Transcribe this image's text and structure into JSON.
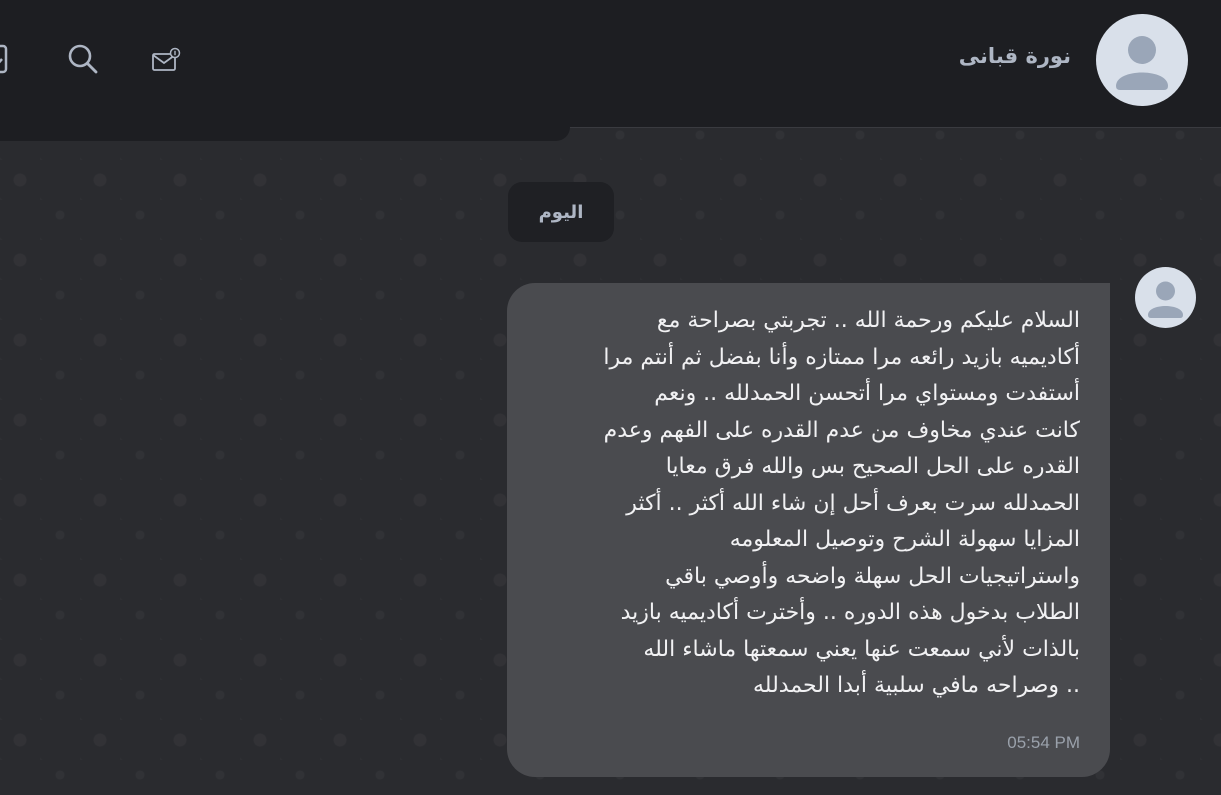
{
  "header": {
    "contact_name": "نورة قبانى",
    "icons": {
      "avatar": "user-avatar-icon",
      "mail": "mail-notification-icon",
      "search": "search-icon",
      "menu": "menu-icon"
    }
  },
  "chat": {
    "date_separator": "اليوم",
    "messages": [
      {
        "text": "السلام عليكم ورحمة الله .. تجربتي بصراحة مع\nأكاديميه بازيد رائعه مرا ممتازه وأنا بفضل ثم أنتم مرا\nأستفدت ومستواي مرا أتحسن الحمدلله .. ونعم\nكانت عندي مخاوف من عدم القدره على الفهم وعدم\nالقدره على الحل الصحيح بس والله فرق معايا\nالحمدلله سرت بعرف أحل إن شاء الله أكثر .. أكثر\nالمزايا سهولة الشرح وتوصيل المعلومه\nواستراتيجيات الحل سهلة واضحه وأوصي باقي\nالطلاب بدخول هذه الدوره .. وأخترت أكاديميه بازيد\nبالذات لأني سمعت عنها يعني سمعتها ماشاء الله\n.. وصراحه مافي سلبية أبدا الحمدلله",
        "time": "05:54 PM"
      }
    ]
  },
  "colors": {
    "header_bg": "#1d1e22",
    "chat_bg": "#2a2b2f",
    "bubble_bg": "#4a4b4f",
    "avatar_bg": "#d9e0ea",
    "avatar_fg": "#9aa6b8"
  }
}
